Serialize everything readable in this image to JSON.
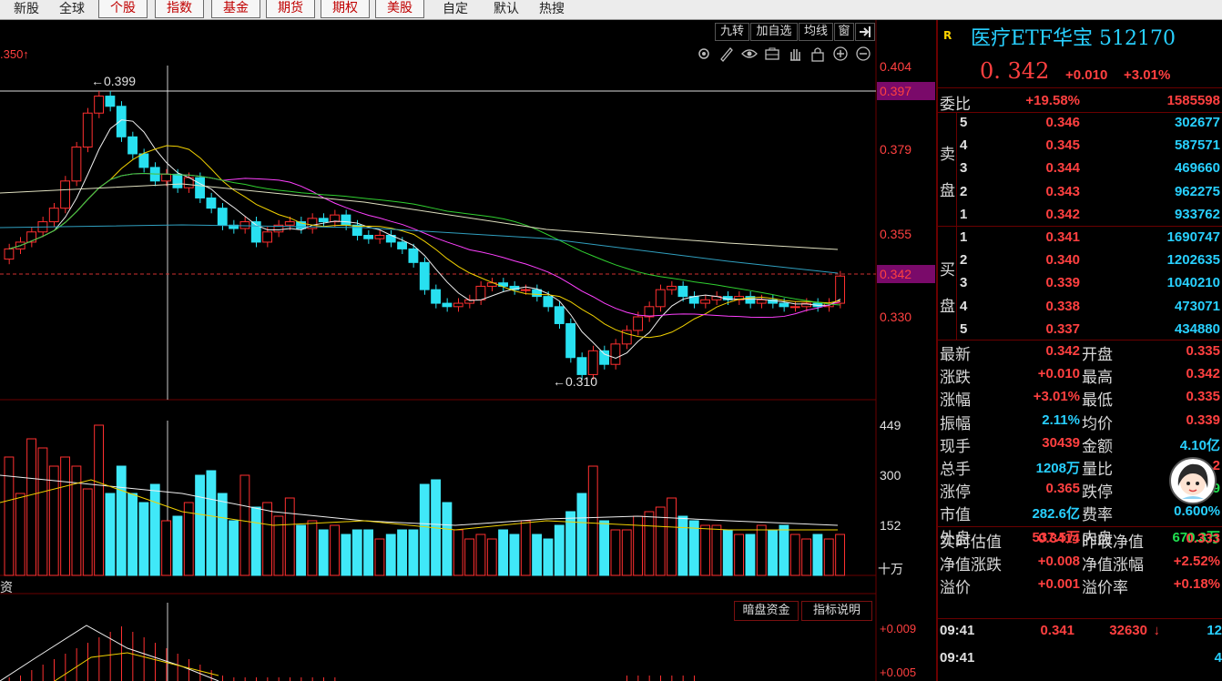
{
  "top_tabs": [
    {
      "label": "新股",
      "boxed": false
    },
    {
      "label": "全球",
      "boxed": false
    },
    {
      "label": "个股",
      "boxed": true
    },
    {
      "label": "指数",
      "boxed": true
    },
    {
      "label": "基金",
      "boxed": true
    },
    {
      "label": "期货",
      "boxed": true
    },
    {
      "label": "期权",
      "boxed": true
    },
    {
      "label": "美股",
      "boxed": true
    },
    {
      "label": "自定",
      "boxed": false
    },
    {
      "label": "默认",
      "boxed": false
    },
    {
      "label": "热搜",
      "boxed": false
    }
  ],
  "toolbar": {
    "jiuzhuan": "九转",
    "add_watch": "加自选",
    "ma_line": "均线",
    "window": "窗",
    "icons": [
      "gear-icon",
      "pen-icon",
      "eye-icon",
      "briefcase-icon",
      "hand-icon",
      "lock-icon",
      "zoom-in-icon",
      "zoom-out-icon"
    ]
  },
  "price_chart": {
    "top_left_label": ".350↑",
    "high_label": "0.399",
    "low_label": "0.310",
    "axis_ticks": [
      "0.404",
      "0.397",
      "0.379",
      "0.355",
      "0.342",
      "0.330"
    ],
    "highlight_ticks": [
      "0.397",
      "0.342"
    ]
  },
  "volume_chart": {
    "axis_ticks": [
      "449",
      "300",
      "152"
    ],
    "unit": "十万"
  },
  "indicator_chart": {
    "left_label": "资",
    "dark_pool_button": "暗盘资金",
    "explain_button": "指标说明",
    "axis_ticks": [
      "+0.009",
      "+0.005"
    ]
  },
  "panel": {
    "r_badge": "R",
    "name": "医疗ETF华宝",
    "code": "512170",
    "price": "0. 342",
    "change": "+0.010",
    "change_pct": "+3.01%",
    "weibi_label": "委比",
    "weibi_pct": "+19.58%",
    "weibi_val": "1585598",
    "sell_label_1": "卖",
    "sell_label_2": "盘",
    "buy_label_1": "买",
    "buy_label_2": "盘",
    "sell": [
      {
        "lvl": "5",
        "price": "0.346",
        "vol": "302677"
      },
      {
        "lvl": "4",
        "price": "0.345",
        "vol": "587571"
      },
      {
        "lvl": "3",
        "price": "0.344",
        "vol": "469660"
      },
      {
        "lvl": "2",
        "price": "0.343",
        "vol": "962275"
      },
      {
        "lvl": "1",
        "price": "0.342",
        "vol": "933762"
      }
    ],
    "buy": [
      {
        "lvl": "1",
        "price": "0.341",
        "vol": "1690747"
      },
      {
        "lvl": "2",
        "price": "0.340",
        "vol": "1202635"
      },
      {
        "lvl": "3",
        "price": "0.339",
        "vol": "1040210"
      },
      {
        "lvl": "4",
        "price": "0.338",
        "vol": "473071"
      },
      {
        "lvl": "5",
        "price": "0.337",
        "vol": "434880"
      }
    ],
    "stats": [
      {
        "l1": "最新",
        "v1": "0.342",
        "c1": "red",
        "l2": "开盘",
        "v2": "0.335",
        "c2": "red"
      },
      {
        "l1": "涨跌",
        "v1": "+0.010",
        "c1": "red",
        "l2": "最高",
        "v2": "0.342",
        "c2": "red"
      },
      {
        "l1": "涨幅",
        "v1": "+3.01%",
        "c1": "red",
        "l2": "最低",
        "v2": "0.335",
        "c2": "red"
      },
      {
        "l1": "振幅",
        "v1": "2.11%",
        "c1": "cyan",
        "l2": "均价",
        "v2": "0.339",
        "c2": "red"
      },
      {
        "l1": "现手",
        "v1": "30439",
        "c1": "red",
        "l2": "金额",
        "v2": "4.10亿",
        "c2": "cyan"
      },
      {
        "l1": "总手",
        "v1": "1208万",
        "c1": "cyan",
        "l2": "量比",
        "v2": "2",
        "c2": "red"
      },
      {
        "l1": "涨停",
        "v1": "0.365",
        "c1": "red",
        "l2": "跌停",
        "v2": "9",
        "c2": "grn"
      },
      {
        "l1": "市值",
        "v1": "282.6亿",
        "c1": "cyan",
        "l2": "费率",
        "v2": "0.600%",
        "c2": "cyan"
      },
      {
        "l1": "外盘",
        "v1": "537.5万",
        "c1": "red",
        "l2": "内盘",
        "v2": "670.3万",
        "c2": "grn"
      }
    ],
    "nav_rows": [
      {
        "l1": "实时估值",
        "v1": "0.3414",
        "l2": "昨收净值",
        "v2": "0.333"
      },
      {
        "l1": "净值涨跌",
        "v1": "+0.008",
        "l2": "净值涨幅",
        "v2": "+2.52%"
      },
      {
        "l1": "溢价",
        "v1": "+0.001",
        "l2": "溢价率",
        "v2": "+0.18%"
      }
    ],
    "ticks": [
      {
        "time": "09:41",
        "price": "0.341",
        "vol": "32630",
        "flag": "↓",
        "n": "12"
      },
      {
        "time": "09:41",
        "price": "",
        "vol": "",
        "flag": "",
        "n": "4"
      }
    ],
    "colors": {
      "up": "#ff4040",
      "down": "#20e050",
      "accent": "#28d0ff",
      "border": "#6a0000"
    }
  }
}
